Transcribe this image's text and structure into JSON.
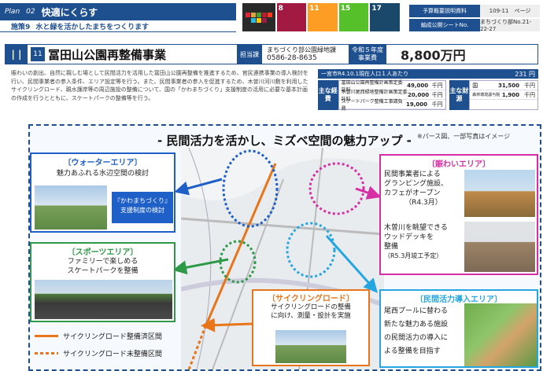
{
  "header": {
    "plan_label": "Plan",
    "plan_num": "02",
    "plan_title": "快適にくらす",
    "policy": "施策9",
    "policy_title": "水と緑を活かしたまちをつくります",
    "sdgs": [
      {
        "num": "8",
        "color": "#a21942"
      },
      {
        "num": "11",
        "color": "#fd9d24"
      },
      {
        "num": "15",
        "color": "#56c02b"
      },
      {
        "num": "17",
        "color": "#19486a"
      }
    ],
    "meta": [
      {
        "k": "予算概要説明資料",
        "v": "109-11　ページ"
      },
      {
        "k": "編成公開シートNo.",
        "v": "まちづくり部No.21-22-27"
      }
    ]
  },
  "title_bar": {
    "icon": "|  |",
    "num": "11",
    "title": "冨田山公園再整備事業",
    "tag1": "担当課",
    "dept1": "まちづくり部公園緑地課",
    "dept2": "0586-28-8635",
    "tag2": "令和５年度事業費",
    "cost": "8,800万円"
  },
  "description": "賑わいの創出、自然に親しむ場として民間活力を活用した冨田山公園再整備を推進するため、官民連携事業の導入検討を行い、民間事業者の参入条件、エリア設定等を行う。また、民間事業者の参入を促進するため、木曽川河川敷を利用したサイクリングロード、親水護岸等の周辺施設の整備について、国の「かわまちづくり」支援制度の活用に必要な基本計画の作成を行うとともに、スケートパークの整備等を行う。",
  "funding": {
    "head": "一宮市R4.10.1現在人口１人あたり",
    "head_value": "231 円",
    "label_left": "主な経費",
    "rows_left": [
      {
        "k": "冨田山公園再整備計画策定委託料",
        "v": "49,000",
        "u": "千円"
      },
      {
        "k": "木曽川尾西緑地整備計画策定委託料",
        "v": "20,000",
        "u": "千円"
      },
      {
        "k": "スケートパーク整備工事請負費",
        "v": "19,000",
        "u": "千円"
      }
    ],
    "label_right": "主な財源",
    "rows_right": [
      {
        "k": "国",
        "v": "31,500",
        "u": "千円"
      },
      {
        "k": "森林環境譲与税",
        "v": "1,900",
        "u": "千円"
      }
    ]
  },
  "main": {
    "title": "- 民間活力を活かし、ミズベ空間の魅力アップ -",
    "note": "※パース図、一部写真はイメージ",
    "water": {
      "title": "〔ウォーターエリア〕",
      "text": "魅力あふれる水辺空間の検討",
      "badge": "『かわまちづくり』支援制度の検討"
    },
    "sports": {
      "title": "〔スポーツエリア〕",
      "text1": "ファミリーで楽しめる",
      "text2": "スケートパークを整備"
    },
    "cycling": {
      "title": "〔サイクリングロード〕",
      "text1": "サイクリングロードの整備",
      "text2": "に向け、測量・設計を実施"
    },
    "lively": {
      "title": "〔賑わいエリア〕",
      "l1": "民間事業者による",
      "l2": "グランピング施設、",
      "l3": "カフェがオープン",
      "l4": "（R4.3月）",
      "m1": "木曽川を眺望できる",
      "m2": "ウッドデッキを",
      "m3": "整備",
      "m4": "（R5.3月竣工予定）"
    },
    "private": {
      "title": "〔民間活力導入エリア〕",
      "l1": "尾西プールに替わる",
      "l2": "新たな魅力ある施設",
      "l3": "の民間活力の導入に",
      "l4": "よる整備を目指す"
    },
    "legend1": "サイクリングロード整備済区間",
    "legend2": "サイクリングロード未整備区間"
  },
  "colors": {
    "navy": "#1e4f8f",
    "blue": "#1f5fc8",
    "green": "#2e9a48",
    "orange": "#e8751a",
    "magenta": "#d62fa6",
    "cyan": "#25a6e0"
  }
}
